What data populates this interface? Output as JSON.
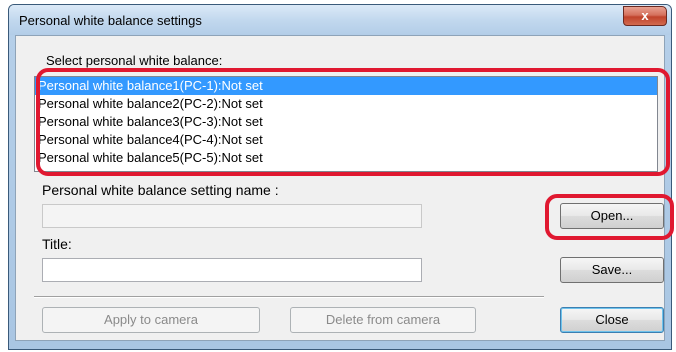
{
  "window": {
    "title": "Personal white balance settings",
    "close_glyph": "x"
  },
  "labels": {
    "select": "Select personal white balance:",
    "setting_name": "Personal white balance setting name :",
    "title": "Title:"
  },
  "list": {
    "items": [
      "Personal white balance1(PC-1):Not set",
      "Personal white balance2(PC-2):Not set",
      "Personal white balance3(PC-3):Not set",
      "Personal white balance4(PC-4):Not set",
      "Personal white balance5(PC-5):Not set"
    ],
    "selected_index": 0
  },
  "fields": {
    "setting_name_value": "",
    "title_value": ""
  },
  "buttons": {
    "open": "Open...",
    "save": "Save...",
    "apply": "Apply to camera",
    "delete": "Delete from camera",
    "close": "Close"
  },
  "colors": {
    "selection": "#3399ff",
    "annotation": "#e01830"
  }
}
